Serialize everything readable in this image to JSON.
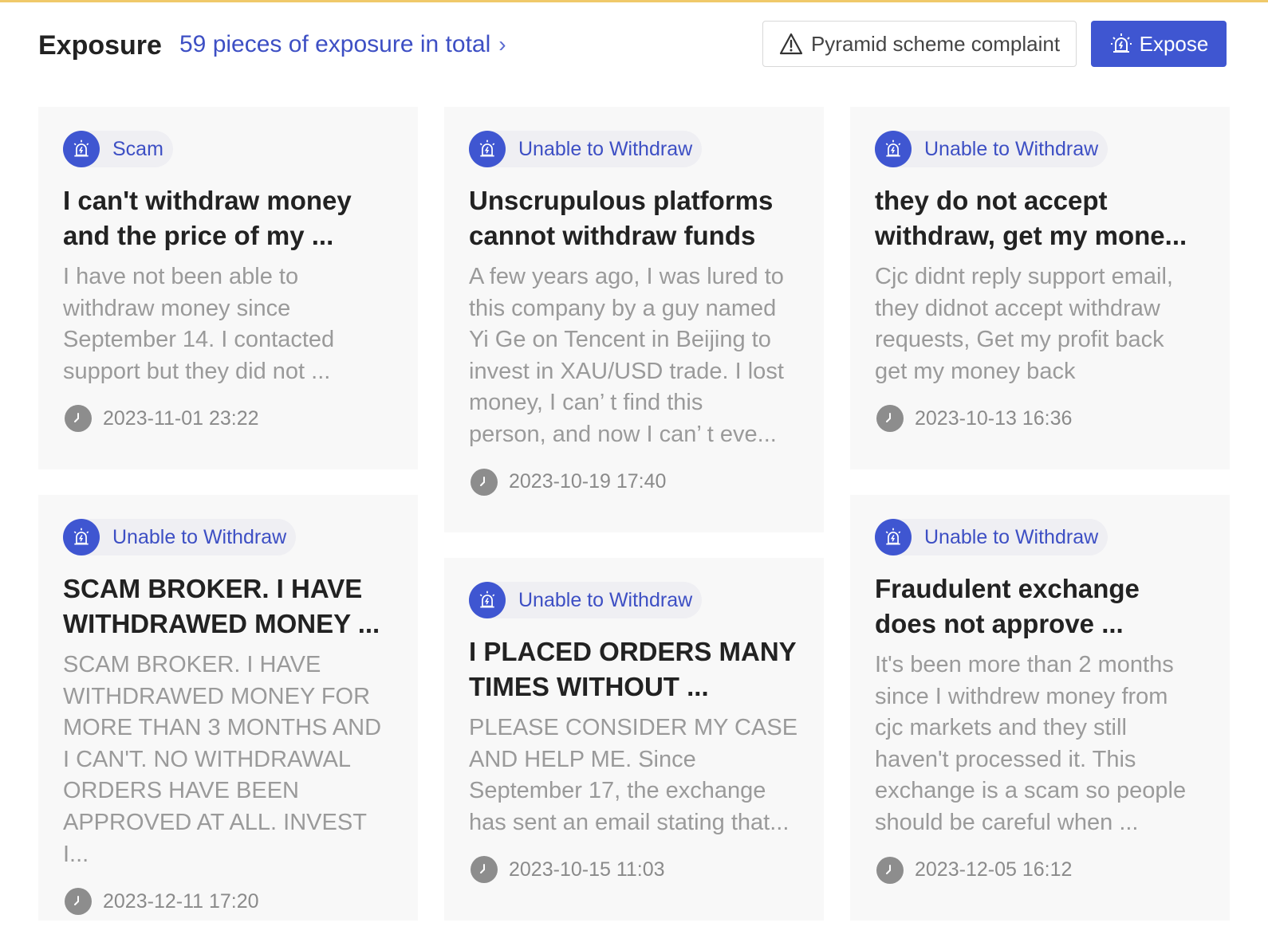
{
  "header": {
    "title": "Exposure",
    "total_link": "59 pieces of exposure in total",
    "complaint_button": "Pyramid scheme complaint",
    "expose_button": "Expose"
  },
  "cards": [
    {
      "tag": "Scam",
      "title_lines": [
        "I can't withdraw money",
        "and the price of my ..."
      ],
      "body_lines": [
        "I have not been able to",
        "withdraw money since",
        "September 14. I contacted",
        "support but they did not ..."
      ],
      "time": "2023-11-01 23:22"
    },
    {
      "tag": "Unable to Withdraw",
      "title_lines": [
        "Unscrupulous platforms",
        "cannot withdraw funds"
      ],
      "body_lines": [
        "A few years ago, I was lured to",
        "this company by a guy named",
        "Yi Ge on Tencent in Beijing to",
        "invest in XAU/USD trade. I lost",
        "money, I can’ t find this",
        "person, and now I can’ t eve..."
      ],
      "time": "2023-10-19 17:40"
    },
    {
      "tag": "Unable to Withdraw",
      "title_lines": [
        "they do not accept",
        "withdraw, get my mone..."
      ],
      "body_lines": [
        "Cjc didnt reply support email,",
        "they didnot accept withdraw",
        "requests, Get my profit back",
        "get my money back"
      ],
      "time": "2023-10-13 16:36"
    },
    {
      "tag": "Unable to Withdraw",
      "title_lines": [
        "SCAM BROKER. I HAVE",
        "WITHDRAWED MONEY ..."
      ],
      "body_lines": [
        "SCAM BROKER. I HAVE",
        "WITHDRAWED MONEY FOR",
        "MORE THAN 3 MONTHS AND",
        "I CAN'T. NO WITHDRAWAL",
        "ORDERS HAVE BEEN",
        "APPROVED AT ALL. INVEST I..."
      ],
      "time": "2023-12-11 17:20"
    },
    {
      "tag": "Unable to Withdraw",
      "title_lines": [
        "I PLACED ORDERS MANY",
        "TIMES WITHOUT ..."
      ],
      "body_lines": [
        "PLEASE CONSIDER MY CASE",
        "AND HELP ME. Since",
        "September 17, the exchange",
        "has sent an email stating that..."
      ],
      "time": "2023-10-15 11:03"
    },
    {
      "tag": "Unable to Withdraw",
      "title_lines": [
        "Fraudulent exchange",
        "does not approve ..."
      ],
      "body_lines": [
        "It's been more than 2 months",
        "since I withdrew money from",
        "cjc markets and they still",
        "haven't processed it. This",
        "exchange is a scam so people",
        "should be careful when ..."
      ],
      "time": "2023-12-05 16:12"
    }
  ]
}
